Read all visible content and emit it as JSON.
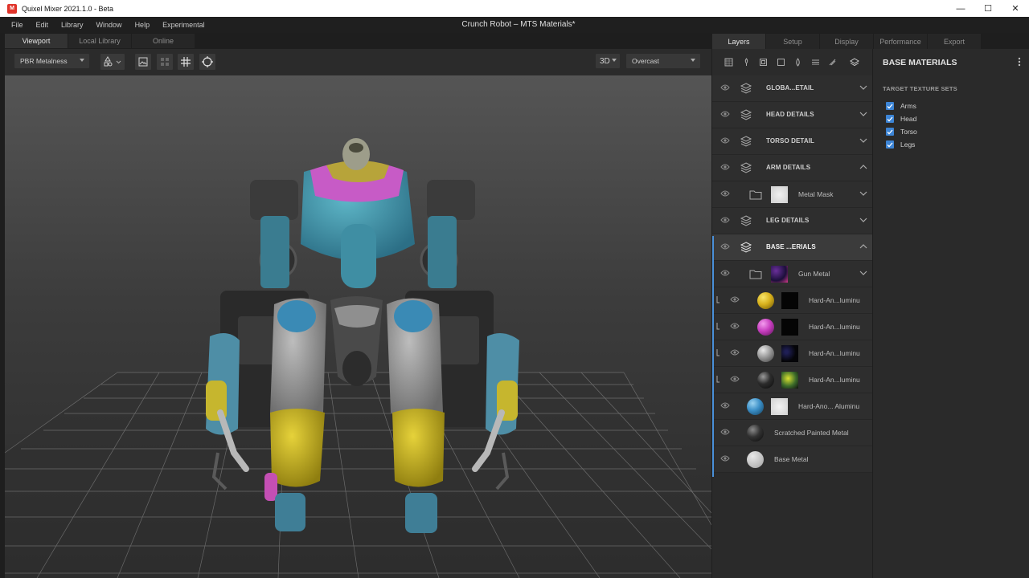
{
  "window": {
    "title": "Quixel Mixer 2021.1.0 - Beta",
    "logo_text": "M",
    "document_title": "Crunch Robot – MTS Materials*",
    "minimize": "—",
    "maximize": "☐",
    "close": "✕"
  },
  "menu": [
    "File",
    "Edit",
    "Library",
    "Window",
    "Help",
    "Experimental"
  ],
  "left_tabs": [
    "Viewport",
    "Local Library",
    "Online"
  ],
  "viewport_toolbar": {
    "render_mode": "PBR Metalness",
    "view_mode": "3D",
    "environment": "Overcast"
  },
  "right_tabs": [
    "Layers",
    "Setup",
    "Display",
    "Performance",
    "Export"
  ],
  "layers": [
    {
      "name": "GLOBA...ETAIL",
      "type": "group",
      "chevron": "down"
    },
    {
      "name": "HEAD DETAILS",
      "type": "group",
      "chevron": "down"
    },
    {
      "name": "TORSO DETAIL",
      "type": "group",
      "chevron": "down"
    },
    {
      "name": "ARM DETAILS",
      "type": "group",
      "chevron": "up"
    },
    {
      "name": "Metal Mask",
      "type": "folder",
      "chevron": "down"
    },
    {
      "name": "LEG DETAILS",
      "type": "group",
      "chevron": "down"
    },
    {
      "name": "BASE ...ERIALS",
      "type": "group",
      "chevron": "up",
      "selected": true
    },
    {
      "name": "Gun Metal",
      "type": "folder",
      "chevron": "down"
    },
    {
      "name": "Hard-An...luminu",
      "type": "material",
      "sphere": "#d8b11c",
      "linked": true
    },
    {
      "name": "Hard-An...luminu",
      "type": "material",
      "sphere": "#c83fc0",
      "linked": true
    },
    {
      "name": "Hard-An...luminu",
      "type": "material",
      "sphere": "#9a9a9a",
      "linked": true
    },
    {
      "name": "Hard-An...luminu",
      "type": "material",
      "sphere": "#2c2c2c",
      "linked": true
    },
    {
      "name": "Hard-Ano... Aluminu",
      "type": "material",
      "sphere": "#3b8fc7"
    },
    {
      "name": "Scratched Painted Metal",
      "type": "material",
      "sphere": "#333333"
    },
    {
      "name": "Base Metal",
      "type": "material",
      "sphere": "#bfbfbf"
    }
  ],
  "properties": {
    "title": "BASE MATERIALS",
    "subtitle": "TARGET TEXTURE SETS",
    "texture_sets": [
      "Arms",
      "Head",
      "Torso",
      "Legs"
    ]
  }
}
